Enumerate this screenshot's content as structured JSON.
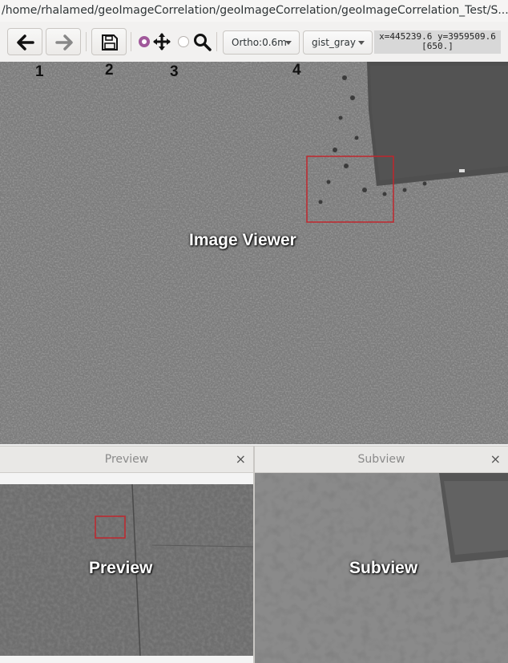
{
  "window": {
    "title": "/home/rhalamed/geoImageCorrelation/geoImageCorrelation/geoImageCorrelation_Test/S..."
  },
  "toolbar": {
    "back_icon": "arrow-left-icon",
    "forward_icon": "arrow-right-icon",
    "save_icon": "floppy-disk-icon",
    "pan_icon": "move-arrows-icon",
    "zoom_icon": "magnifier-icon",
    "pan_selected": true,
    "zoom_selected": false,
    "resolution_select": "Ortho:0.6m",
    "colormap_select": "gist_gray",
    "coords_line1": "x=445239.6 y=3959509.6",
    "coords_line2": "[650.]"
  },
  "annotations": [
    "1",
    "2",
    "3",
    "4"
  ],
  "viewer": {
    "label": "Image Viewer",
    "roi_color": "#c0262d"
  },
  "preview": {
    "title": "Preview",
    "close": "×",
    "label": "Preview"
  },
  "subview": {
    "title": "Subview",
    "close": "×",
    "label": "Subview"
  },
  "colors": {
    "radio_accent": "#a0589a",
    "roi_box": "#c0262d"
  }
}
